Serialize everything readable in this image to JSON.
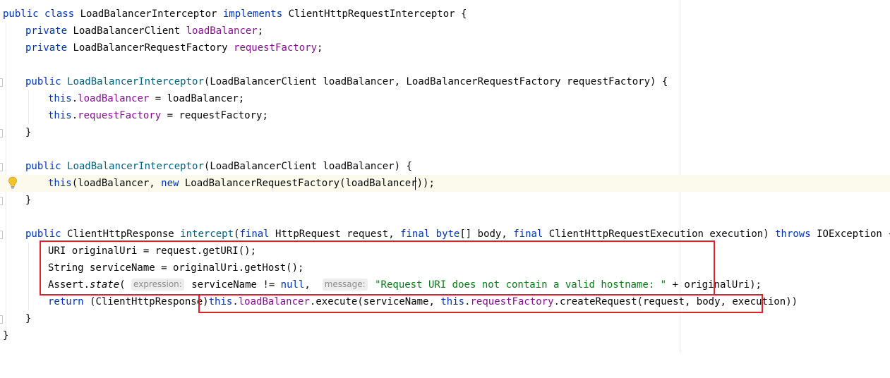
{
  "editor": {
    "icons": {
      "intention": "lightbulb-icon"
    },
    "colors": {
      "keyword": "#0033b3",
      "field": "#871094",
      "method": "#00627a",
      "string": "#067d17",
      "hint_bg": "#ededed",
      "current_line": "#fcfaed",
      "annotation_box": "#e0202e"
    },
    "code": {
      "l1_kw1": "public class ",
      "l1_name": "LoadBalancerInterceptor ",
      "l1_kw2": "implements ",
      "l1_rest": "ClientHttpRequestInterceptor {",
      "l2_kw": "private ",
      "l2_type": "LoadBalancerClient ",
      "l2_field": "loadBalancer",
      "l2_end": ";",
      "l3_kw": "private ",
      "l3_type": "LoadBalancerRequestFactory ",
      "l3_field": "requestFactory",
      "l3_end": ";",
      "l5_kw": "public ",
      "l5_ctor": "LoadBalancerInterceptor",
      "l5_rest": "(LoadBalancerClient loadBalancer, LoadBalancerRequestFactory requestFactory) {",
      "l6_kw": "this",
      "l6_dot": ".",
      "l6_field": "loadBalancer",
      "l6_rest": " = loadBalancer;",
      "l7_kw": "this",
      "l7_dot": ".",
      "l7_field": "requestFactory",
      "l7_rest": " = requestFactory;",
      "l8": "}",
      "l10_kw": "public ",
      "l10_ctor": "LoadBalancerInterceptor",
      "l10_rest": "(LoadBalancerClient loadBalancer) {",
      "l11_kw1": "this",
      "l11_mid": "(loadBalancer, ",
      "l11_kw2": "new ",
      "l11_rest": "LoadBalancerRequestFactory(loadBalancer));",
      "l12": "}",
      "l14_kw1": "public ",
      "l14_type": "ClientHttpResponse ",
      "l14_method": "intercept",
      "l14_p1": "(",
      "l14_kw2": "final ",
      "l14_p2": "HttpRequest request, ",
      "l14_kw3": "final byte",
      "l14_p3": "[] body, ",
      "l14_kw4": "final ",
      "l14_p4": "ClientHttpRequestExecution execution) ",
      "l14_kw5": "throws ",
      "l14_p5": "IOException {",
      "l15": "URI originalUri = request.getURI();",
      "l16": "String serviceName = originalUri.getHost();",
      "l17_a": "Assert.",
      "l17_state": "state",
      "l17_b": "( ",
      "l17_hint1": "expression:",
      "l17_c": " serviceName != ",
      "l17_null": "null",
      "l17_d": ",  ",
      "l17_hint2": "message:",
      "l17_str": " \"Request URI does not contain a valid hostname: \"",
      "l17_e": " + originalUri);",
      "l18_kw": "return ",
      "l18_cast": "(ClientHttpResponse)",
      "l18_this1": "this",
      "l18_dot1": ".",
      "l18_f1": "loadBalancer",
      "l18_mid": ".execute(serviceName, ",
      "l18_this2": "this",
      "l18_dot2": ".",
      "l18_f2": "requestFactory",
      "l18_end": ".createRequest(request, body, execution))",
      "l19": "}",
      "l20": "}"
    }
  }
}
